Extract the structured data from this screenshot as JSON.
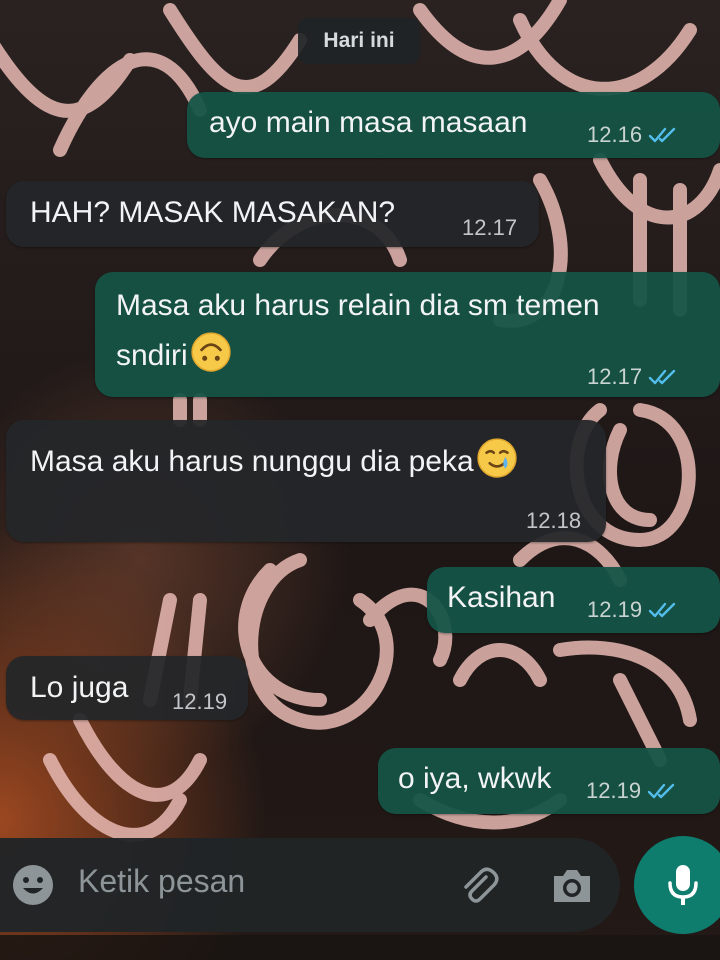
{
  "date_chip": "Hari ini",
  "messages": [
    {
      "dir": "out",
      "text": "ayo main masa masaan",
      "time": "12.16"
    },
    {
      "dir": "in",
      "text": "HAH? MASAK MASAKAN?",
      "time": "12.17"
    },
    {
      "dir": "out",
      "text_line1": "Masa aku harus relain dia sm temen",
      "text_line2": "sndiri",
      "emoji": "upside-down-face",
      "time": "12.17"
    },
    {
      "dir": "in",
      "text": "Masa aku harus nunggu dia peka",
      "emoji": "smiling-face-with-tear",
      "time": "12.18"
    },
    {
      "dir": "out",
      "text": "Kasihan",
      "time": "12.19"
    },
    {
      "dir": "in",
      "text": "Lo juga",
      "time": "12.19"
    },
    {
      "dir": "out",
      "text": "o iya, wkwk",
      "time": "12.19"
    }
  ],
  "input": {
    "placeholder": "Ketik pesan"
  },
  "icons": {
    "emoji": "emoji-icon",
    "attach": "paperclip-icon",
    "camera": "camera-icon",
    "mic": "microphone-icon",
    "read_receipt": "double-check-icon"
  },
  "colors": {
    "outgoing_bubble": "#145446",
    "incoming_bubble": "#242629",
    "read_ticks": "#53bdeb",
    "send_button": "#0e7d6e"
  }
}
